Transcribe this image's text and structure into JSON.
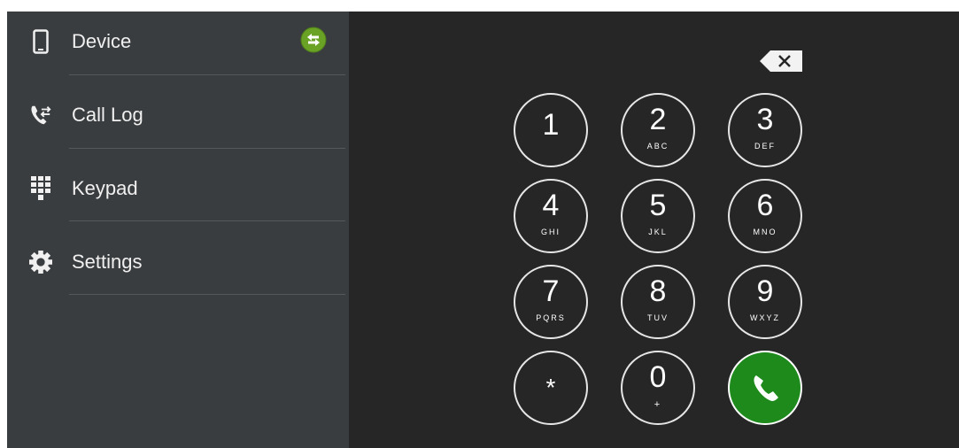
{
  "sidebar": {
    "items": [
      {
        "label": "Device",
        "icon": "phone-device-icon"
      },
      {
        "label": "Call Log",
        "icon": "call-log-icon"
      },
      {
        "label": "Keypad",
        "icon": "keypad-icon"
      },
      {
        "label": "Settings",
        "icon": "gear-icon"
      }
    ],
    "sync_icon": "sync-arrows-icon"
  },
  "dialer": {
    "keys": [
      {
        "digit": "1",
        "letters": ""
      },
      {
        "digit": "2",
        "letters": "ABC"
      },
      {
        "digit": "3",
        "letters": "DEF"
      },
      {
        "digit": "4",
        "letters": "GHI"
      },
      {
        "digit": "5",
        "letters": "JKL"
      },
      {
        "digit": "6",
        "letters": "MNO"
      },
      {
        "digit": "7",
        "letters": "PQRS"
      },
      {
        "digit": "8",
        "letters": "TUV"
      },
      {
        "digit": "9",
        "letters": "WXYZ"
      },
      {
        "digit": "*",
        "letters": ""
      },
      {
        "digit": "0",
        "letters": "+"
      }
    ],
    "call_icon": "phone-call-icon",
    "backspace_icon": "backspace-icon"
  },
  "colors": {
    "sidebar_bg": "#3a3d3f",
    "dialer_bg": "#262626",
    "call_green": "#1e8a1c",
    "sync_green": "#6aa226"
  }
}
